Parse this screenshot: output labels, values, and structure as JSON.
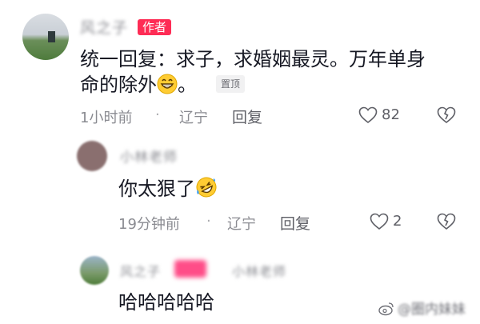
{
  "comments": [
    {
      "username": "风之子",
      "author_tag": "作者",
      "text_line1": "统一回复：求子，求婚姻最灵。万年单身",
      "text_line2": "命的除外",
      "text_tail": "。",
      "emoji_icon": "grinning-face-icon",
      "pin_label": "置顶",
      "time": "1小时前",
      "location": "辽宁",
      "reply_label": "回复",
      "like_count": "82"
    },
    {
      "username": "小林老师",
      "text": "你太狠了",
      "emoji_icon": "rolling-on-floor-laughing-icon",
      "time": "19分钟前",
      "location": "辽宁",
      "reply_label": "回复",
      "like_count": "2"
    },
    {
      "username": "风之子",
      "username_suffix": "小林老师",
      "text": "哈哈哈哈哈"
    }
  ],
  "separator_dot": "·",
  "watermark": {
    "text": "@圈内妹妹"
  },
  "colors": {
    "author_tag": "#fe2c55",
    "meta_text": "#8a8b91",
    "body_text": "#161823"
  }
}
